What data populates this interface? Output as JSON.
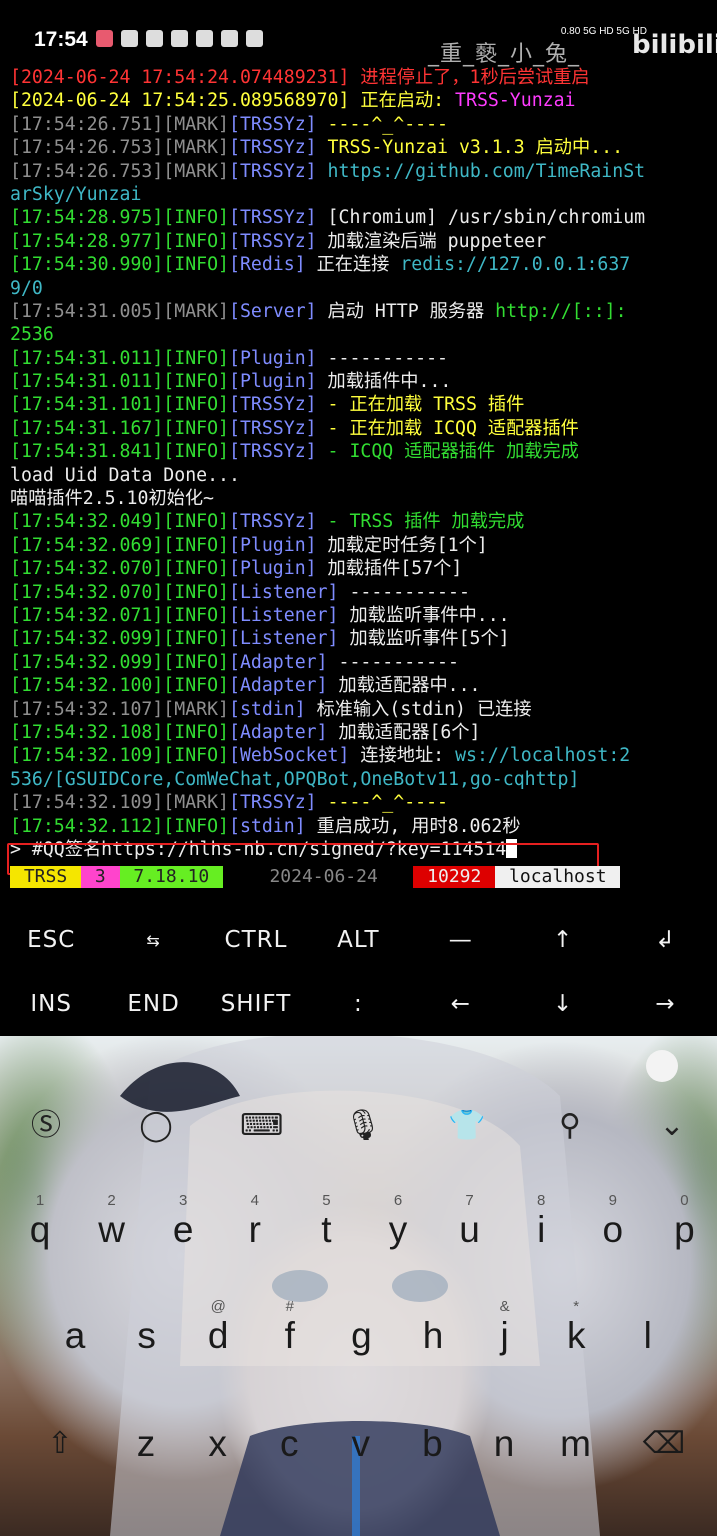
{
  "status_bar": {
    "time": "17:54",
    "net_info": "0.80 5G HD 5G HD",
    "watermark": "_重_褻_小_兔_",
    "brand": "bilibili"
  },
  "terminal": {
    "lines": [
      [
        {
          "t": "[2024-06-24 17:54:24.074489231] 进程停止了，1秒后尝试重启",
          "c": "c-red"
        }
      ],
      [
        {
          "t": "[2024-06-24 17:54:25.089568970] 正在启动: ",
          "c": "c-yel"
        },
        {
          "t": "TRSS-Yunzai",
          "c": "c-mag"
        }
      ],
      [
        {
          "t": "[17:54:26.751][MARK]",
          "c": "c-gray"
        },
        {
          "t": "[TRSSYz]",
          "c": "c-blu"
        },
        {
          "t": " ----^_^----",
          "c": "c-yel"
        }
      ],
      [
        {
          "t": "[17:54:26.753][MARK]",
          "c": "c-gray"
        },
        {
          "t": "[TRSSYz]",
          "c": "c-blu"
        },
        {
          "t": " TRSS-Yunzai v3.1.3 启动中...",
          "c": "c-yel"
        }
      ],
      [
        {
          "t": "[17:54:26.753][MARK]",
          "c": "c-gray"
        },
        {
          "t": "[TRSSYz]",
          "c": "c-blu"
        },
        {
          "t": " https://github.com/TimeRainSt",
          "c": "c-cyn"
        }
      ],
      [
        {
          "t": "arSky/Yunzai",
          "c": "c-cyn"
        }
      ],
      [
        {
          "t": "[17:54:28.975][INFO]",
          "c": "c-grn"
        },
        {
          "t": "[TRSSYz]",
          "c": "c-blu"
        },
        {
          "t": " [Chromium] /usr/sbin/chromium",
          "c": "c-wht"
        }
      ],
      [
        {
          "t": "[17:54:28.977][INFO]",
          "c": "c-grn"
        },
        {
          "t": "[TRSSYz]",
          "c": "c-blu"
        },
        {
          "t": " 加载渲染后端 puppeteer",
          "c": "c-wht"
        }
      ],
      [
        {
          "t": "[17:54:30.990][INFO]",
          "c": "c-grn"
        },
        {
          "t": "[Redis]",
          "c": "c-blu"
        },
        {
          "t": " 正在连接 ",
          "c": "c-wht"
        },
        {
          "t": "redis://127.0.0.1:637",
          "c": "c-cyn"
        }
      ],
      [
        {
          "t": "9/0",
          "c": "c-cyn"
        }
      ],
      [
        {
          "t": "[17:54:31.005][MARK]",
          "c": "c-gray"
        },
        {
          "t": "[Server]",
          "c": "c-blu"
        },
        {
          "t": " 启动 HTTP 服务器 ",
          "c": "c-wht"
        },
        {
          "t": "http://[::]:",
          "c": "c-grn"
        }
      ],
      [
        {
          "t": "2536",
          "c": "c-grn"
        }
      ],
      [
        {
          "t": "[17:54:31.011][INFO]",
          "c": "c-grn"
        },
        {
          "t": "[Plugin]",
          "c": "c-blu"
        },
        {
          "t": " -----------",
          "c": "c-wht"
        }
      ],
      [
        {
          "t": "[17:54:31.011][INFO]",
          "c": "c-grn"
        },
        {
          "t": "[Plugin]",
          "c": "c-blu"
        },
        {
          "t": " 加载插件中...",
          "c": "c-wht"
        }
      ],
      [
        {
          "t": "[17:54:31.101][INFO]",
          "c": "c-grn"
        },
        {
          "t": "[TRSSYz]",
          "c": "c-blu"
        },
        {
          "t": " - 正在加载 TRSS 插件",
          "c": "c-yel"
        }
      ],
      [
        {
          "t": "[17:54:31.167][INFO]",
          "c": "c-grn"
        },
        {
          "t": "[TRSSYz]",
          "c": "c-blu"
        },
        {
          "t": " - 正在加载 ICQQ 适配器插件",
          "c": "c-yel"
        }
      ],
      [
        {
          "t": "[17:54:31.841][INFO]",
          "c": "c-grn"
        },
        {
          "t": "[TRSSYz]",
          "c": "c-blu"
        },
        {
          "t": " - ICQQ 适配器插件 加载完成",
          "c": "c-grn"
        }
      ],
      [
        {
          "t": "load Uid Data Done...",
          "c": "c-wht"
        }
      ],
      [
        {
          "t": "喵喵插件2.5.10初始化~",
          "c": "c-wht"
        }
      ],
      [
        {
          "t": "[17:54:32.049][INFO]",
          "c": "c-grn"
        },
        {
          "t": "[TRSSYz]",
          "c": "c-blu"
        },
        {
          "t": " - TRSS 插件 加载完成",
          "c": "c-grn"
        }
      ],
      [
        {
          "t": "[17:54:32.069][INFO]",
          "c": "c-grn"
        },
        {
          "t": "[Plugin]",
          "c": "c-blu"
        },
        {
          "t": " 加载定时任务[1个]",
          "c": "c-wht"
        }
      ],
      [
        {
          "t": "[17:54:32.070][INFO]",
          "c": "c-grn"
        },
        {
          "t": "[Plugin]",
          "c": "c-blu"
        },
        {
          "t": " 加载插件[57个]",
          "c": "c-wht"
        }
      ],
      [
        {
          "t": "[17:54:32.070][INFO]",
          "c": "c-grn"
        },
        {
          "t": "[Listener]",
          "c": "c-blu"
        },
        {
          "t": " -----------",
          "c": "c-wht"
        }
      ],
      [
        {
          "t": "[17:54:32.071][INFO]",
          "c": "c-grn"
        },
        {
          "t": "[Listener]",
          "c": "c-blu"
        },
        {
          "t": " 加载监听事件中...",
          "c": "c-wht"
        }
      ],
      [
        {
          "t": "[17:54:32.099][INFO]",
          "c": "c-grn"
        },
        {
          "t": "[Listener]",
          "c": "c-blu"
        },
        {
          "t": " 加载监听事件[5个]",
          "c": "c-wht"
        }
      ],
      [
        {
          "t": "[17:54:32.099][INFO]",
          "c": "c-grn"
        },
        {
          "t": "[Adapter]",
          "c": "c-blu"
        },
        {
          "t": " -----------",
          "c": "c-wht"
        }
      ],
      [
        {
          "t": "[17:54:32.100][INFO]",
          "c": "c-grn"
        },
        {
          "t": "[Adapter]",
          "c": "c-blu"
        },
        {
          "t": " 加载适配器中...",
          "c": "c-wht"
        }
      ],
      [
        {
          "t": "[17:54:32.107][MARK]",
          "c": "c-gray"
        },
        {
          "t": "[stdin]",
          "c": "c-blu"
        },
        {
          "t": " 标准输入(stdin) 已连接",
          "c": "c-wht"
        }
      ],
      [
        {
          "t": "[17:54:32.108][INFO]",
          "c": "c-grn"
        },
        {
          "t": "[Adapter]",
          "c": "c-blu"
        },
        {
          "t": " 加载适配器[6个]",
          "c": "c-wht"
        }
      ],
      [
        {
          "t": "[17:54:32.109][INFO]",
          "c": "c-grn"
        },
        {
          "t": "[WebSocket]",
          "c": "c-blu"
        },
        {
          "t": " 连接地址: ",
          "c": "c-wht"
        },
        {
          "t": "ws://localhost:2",
          "c": "c-cyn"
        }
      ],
      [
        {
          "t": "536/[GSUIDCore,ComWeChat,OPQBot,OneBotv11,go-cqhttp]",
          "c": "c-cyn"
        }
      ],
      [
        {
          "t": "[17:54:32.109][MARK]",
          "c": "c-gray"
        },
        {
          "t": "[TRSSYz]",
          "c": "c-blu"
        },
        {
          "t": " ----^_^----",
          "c": "c-yel"
        }
      ],
      [
        {
          "t": "[17:54:32.112][INFO]",
          "c": "c-grn"
        },
        {
          "t": "[stdin]",
          "c": "c-blu"
        },
        {
          "t": " 重启成功, 用时8.062秒",
          "c": "c-wht"
        }
      ]
    ],
    "prompt": "> ",
    "command": "#QQ签名https://hlhs-nb.cn/signed/?key=114514"
  },
  "tmux_bar": [
    {
      "t": " TRSS ",
      "bg": "#f5e600",
      "fg": "#222"
    },
    {
      "t": " 3 ",
      "bg": "#ff44cc",
      "fg": "#222"
    },
    {
      "t": " 7.18.10 ",
      "bg": "#66ee22",
      "fg": "#222"
    },
    {
      "t": "    2024-06-24   ",
      "bg": "#000000",
      "fg": "#888"
    },
    {
      "t": " 10292 ",
      "bg": "#dd0000",
      "fg": "#eee"
    },
    {
      "t": " localhost ",
      "bg": "#f0f0f0",
      "fg": "#111"
    }
  ],
  "extra_keys": {
    "row1": [
      "ESC",
      "⇆",
      "CTRL",
      "ALT",
      "—",
      "↑",
      "↲"
    ],
    "row2": [
      "INS",
      "END",
      "SHIFT",
      ":",
      "←",
      "↓",
      "→"
    ]
  },
  "keyboard": {
    "row1": [
      {
        "hint": "1",
        "ch": "q"
      },
      {
        "hint": "2",
        "ch": "w"
      },
      {
        "hint": "3",
        "ch": "e"
      },
      {
        "hint": "4",
        "ch": "r"
      },
      {
        "hint": "5",
        "ch": "t"
      },
      {
        "hint": "6",
        "ch": "y"
      },
      {
        "hint": "7",
        "ch": "u"
      },
      {
        "hint": "8",
        "ch": "i"
      },
      {
        "hint": "9",
        "ch": "o"
      },
      {
        "hint": "0",
        "ch": "p"
      }
    ],
    "row2": [
      {
        "hint": "",
        "ch": "a"
      },
      {
        "hint": "",
        "ch": "s"
      },
      {
        "hint": "@",
        "ch": "d"
      },
      {
        "hint": "#",
        "ch": "f"
      },
      {
        "hint": "",
        "ch": "g"
      },
      {
        "hint": "",
        "ch": "h"
      },
      {
        "hint": "&",
        "ch": "j"
      },
      {
        "hint": "*",
        "ch": "k"
      },
      {
        "hint": "",
        "ch": "l"
      }
    ],
    "row3": [
      {
        "hint": "",
        "ch": "z"
      },
      {
        "hint": "",
        "ch": "x"
      },
      {
        "hint": "",
        "ch": "c"
      },
      {
        "hint": "",
        "ch": "v"
      },
      {
        "hint": "",
        "ch": "b"
      },
      {
        "hint": "",
        "ch": "n"
      },
      {
        "hint": "",
        "ch": "m"
      }
    ]
  }
}
